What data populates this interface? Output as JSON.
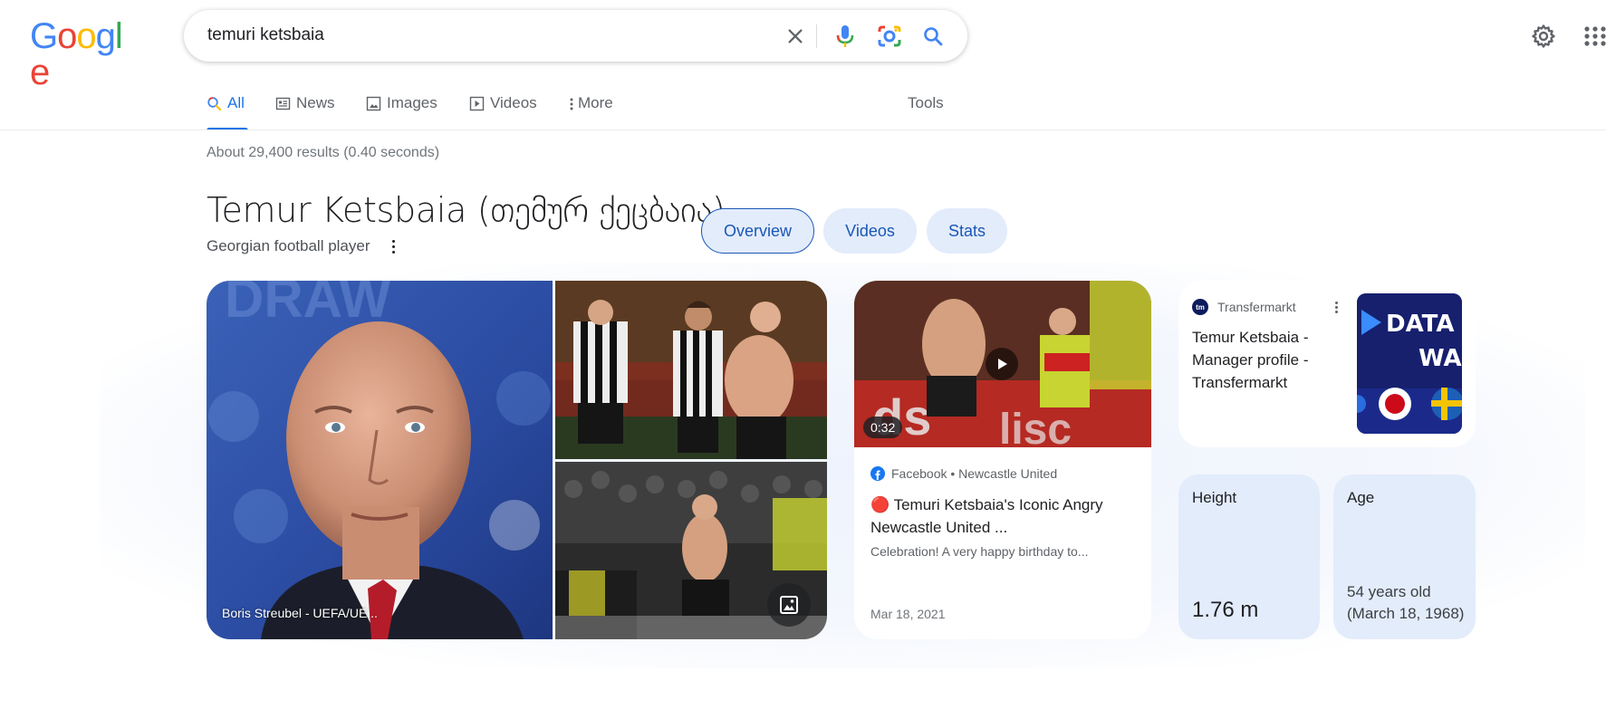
{
  "header": {
    "logo_letters": [
      {
        "char": "G",
        "color": "#4285F4"
      },
      {
        "char": "o",
        "color": "#EA4335"
      },
      {
        "char": "o",
        "color": "#FBBC05"
      },
      {
        "char": "g",
        "color": "#4285F4"
      },
      {
        "char": "l",
        "color": "#34A853"
      },
      {
        "char": "e",
        "color": "#EA4335"
      }
    ],
    "search_query": "temuri ketsbaia",
    "icons": [
      "clear-icon",
      "mic-icon",
      "lens-icon",
      "search-icon",
      "settings-icon",
      "apps-icon"
    ]
  },
  "tabs": [
    {
      "label": "All",
      "icon": "search-icon",
      "active": true
    },
    {
      "label": "News",
      "icon": "news-icon"
    },
    {
      "label": "Images",
      "icon": "image-icon"
    },
    {
      "label": "Videos",
      "icon": "video-icon"
    },
    {
      "label": "More",
      "icon": "dots-vertical-icon"
    }
  ],
  "tools_label": "Tools",
  "result_stats": "About 29,400 results (0.40 seconds)",
  "entity": {
    "title": "Temur Ketsbaia (თემურ ქეცბაია)",
    "subtitle": "Georgian football player",
    "chips": [
      "Overview",
      "Videos",
      "Stats"
    ]
  },
  "images": {
    "main_caption": "Boris Streubel - UEFA/UE..."
  },
  "video_card": {
    "duration": "0:32",
    "source": "Facebook • Newcastle United",
    "title": "🔴 Temuri Ketsbaia's Iconic Angry Newcastle United ...",
    "description": "Celebration! A very happy birthday to...",
    "date": "Mar 18, 2021"
  },
  "transfermarkt_card": {
    "source": "Transfermarkt",
    "title": "Temur Ketsbaia - Manager profile - Transfermarkt",
    "thumb_text": [
      "DATA",
      "WA"
    ]
  },
  "facts": [
    {
      "label": "Height",
      "value": "1.76 m"
    },
    {
      "label": "Age",
      "value": "54 years old (March 18, 1968)"
    }
  ],
  "colors": {
    "accent": "#1a73e8",
    "chip_bg": "#e3ecfb",
    "chip_text": "#1a57b7"
  }
}
